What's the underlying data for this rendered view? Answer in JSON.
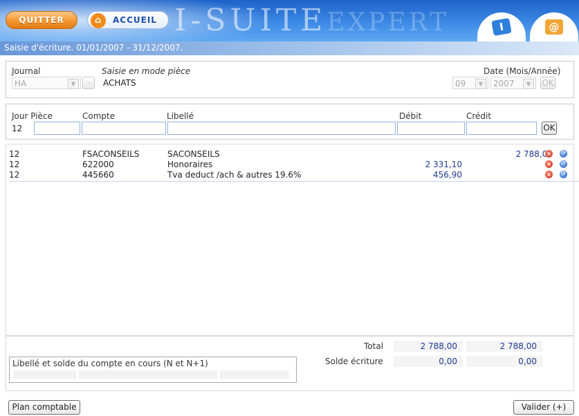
{
  "header": {
    "quit_label": "QUITTER",
    "home_label": "ACCUEIL",
    "logo_main": "I-SUITE",
    "logo_sub": "EXPERT",
    "tab_i_label": "I",
    "tab_mail_label": "@"
  },
  "title": "Saisie d'écriture. 01/01/2007 - 31/12/2007.",
  "journal_panel": {
    "journal_label": "Journal",
    "journal_value": "HA",
    "browse_label": "...",
    "mode_label": "Saisie en mode pièce",
    "mode_value": "ACHATS",
    "date_label": "Date (Mois/Année)",
    "month_value": "09",
    "year_value": "2007",
    "ok_label": "OK"
  },
  "entry_panel": {
    "headers": {
      "jour_piece": "Jour Pièce",
      "compte": "Compte",
      "libelle": "Libellé",
      "debit": "Débit",
      "credit": "Crédit"
    },
    "jour_value": "12",
    "piece_value": "",
    "compte_value": "",
    "libelle_value": "",
    "debit_value": "",
    "credit_value": "",
    "ok_label": "OK"
  },
  "lines": [
    {
      "jour": "12",
      "compte": "FSACONSEILS",
      "libelle": "SACONSEILS",
      "debit": "",
      "credit": "2 788,00"
    },
    {
      "jour": "12",
      "compte": "622000",
      "libelle": "Honoraires",
      "debit": "2 331,10",
      "credit": ""
    },
    {
      "jour": "12",
      "compte": "445660",
      "libelle": "Tva deduct /ach & autres 19.6%",
      "debit": "456,90",
      "credit": ""
    }
  ],
  "totals": {
    "total_label": "Total",
    "total_debit": "2 788,00",
    "total_credit": "2 788,00",
    "solde_label": "Solde écriture",
    "solde_debit": "0,00",
    "solde_credit": "0,00"
  },
  "account_box": {
    "label": "Libellé et solde du compte en cours (N et N+1)"
  },
  "footer": {
    "plan_label": "Plan comptable",
    "validate_label": "Valider (+)"
  },
  "colors": {
    "banner": "#3d8ae6",
    "quit_orange": "#f59a36",
    "amount_blue": "#1d3a8f",
    "delete_red": "#c8321c",
    "edit_blue": "#2a62c1"
  }
}
